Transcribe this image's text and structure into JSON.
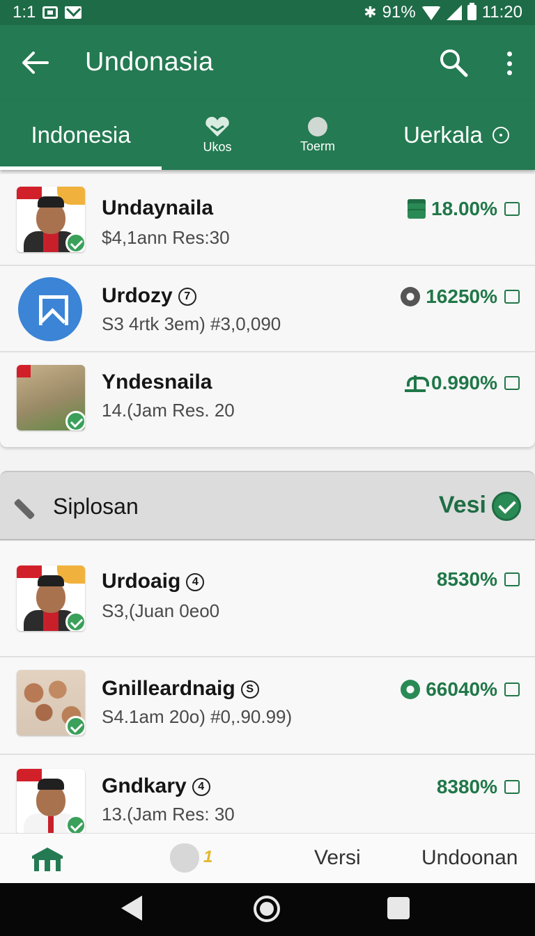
{
  "statusbar": {
    "time_left": "1:1",
    "battery_text": "91%",
    "clock": "11:20"
  },
  "appbar": {
    "title": "Undonasia",
    "back_icon": "arrow-left-icon",
    "search_icon": "search-icon",
    "more_icon": "more-vert-icon"
  },
  "tabs": [
    {
      "label": "Indonesia",
      "selected": true
    },
    {
      "label": "Ukos",
      "icon": "heart-icon"
    },
    {
      "label": "Toerm",
      "icon": "circle-icon"
    },
    {
      "label": "Uerkala",
      "icon": "info-icon"
    }
  ],
  "top_list": [
    {
      "name": "Undaynaila",
      "badge": "",
      "sub": "$4,1ann Res:30",
      "stat": "18.00%",
      "stat_icon": "document-icon"
    },
    {
      "name": "Urdozy",
      "badge": "7",
      "sub": "S3 4rtk 3em) #3,0,090",
      "stat": "16250%",
      "stat_icon": "gear-icon"
    },
    {
      "name": "Yndesnaila",
      "badge": "",
      "sub": "14.(Jam Res. 20",
      "stat": "0.990%",
      "stat_icon": "plant-icon"
    }
  ],
  "section": {
    "title": "Siplosan",
    "action": "Vesi"
  },
  "bottom_list": [
    {
      "name": "Urdoaig",
      "badge": "4",
      "sub": "S3,(Juan 0eo0",
      "stat": "8530%",
      "stat_icon": ""
    },
    {
      "name": "Gnilleardnaig",
      "badge": "S",
      "sub": "S4.1am 20o) #0,.90.99)",
      "stat": "66040%",
      "stat_icon": "gear-icon"
    },
    {
      "name": "Gndkary",
      "badge": "4",
      "sub": "13.(Jam Res: 30",
      "stat": "8380%",
      "stat_icon": ""
    }
  ],
  "bottomnav": {
    "badge_count": "1",
    "versi": "Versi",
    "undoonan": "Undoonan"
  },
  "colors": {
    "primary": "#247a52",
    "accent": "#207748",
    "blue": "#3b84d6"
  }
}
